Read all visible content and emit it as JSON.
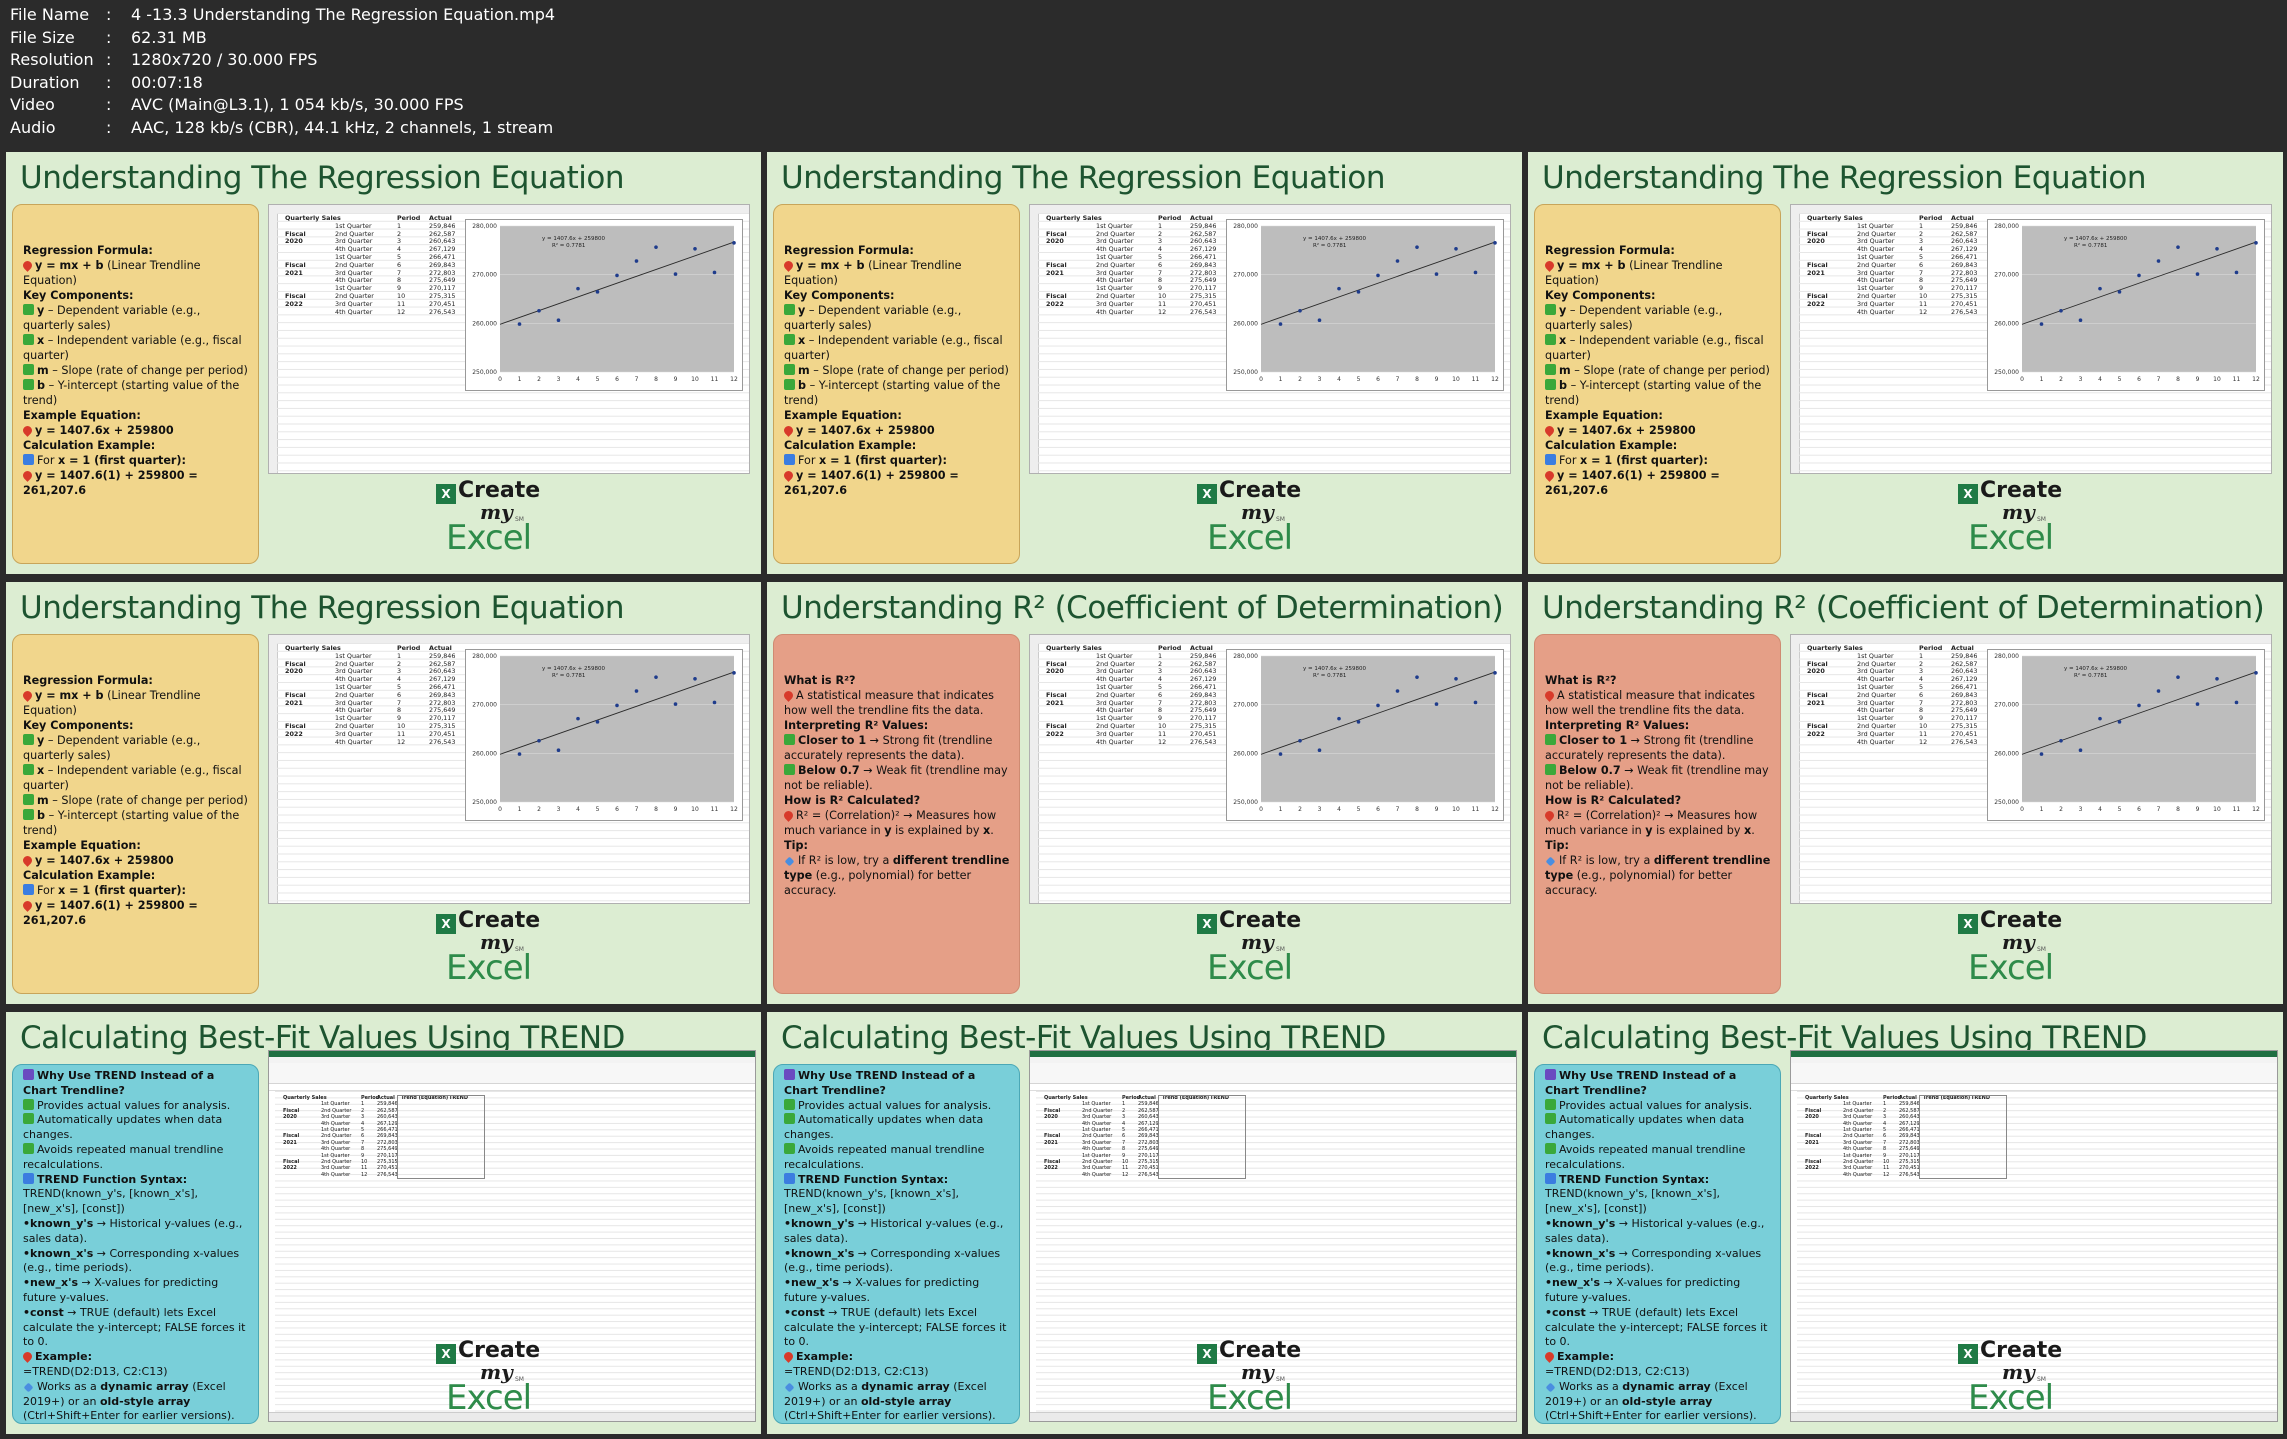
{
  "file_info": [
    {
      "key": "File Name",
      "value": "4 -13.3 Understanding The Regression Equation.mp4"
    },
    {
      "key": "File Size",
      "value": "62.31 MB"
    },
    {
      "key": "Resolution",
      "value": "1280x720 / 30.000 FPS"
    },
    {
      "key": "Duration",
      "value": "00:07:18"
    },
    {
      "key": "Video",
      "value": "AVC (Main@L3.1), 1 054 kb/s, 30.000 FPS"
    },
    {
      "key": "Audio",
      "value": "AAC, 128 kb/s (CBR), 44.1 kHz, 2 channels, 1 stream"
    }
  ],
  "slides": [
    {
      "title": "Understanding The Regression Equation",
      "panel": "regression"
    },
    {
      "title": "Understanding The Regression Equation",
      "panel": "regression"
    },
    {
      "title": "Understanding The Regression Equation",
      "panel": "regression"
    },
    {
      "title": "Understanding The Regression Equation",
      "panel": "regression"
    },
    {
      "title": "Understanding R² (Coefficient of Determination)",
      "panel": "r2"
    },
    {
      "title": "Understanding R² (Coefficient of Determination)",
      "panel": "r2"
    },
    {
      "title": "Calculating Best-Fit Values Using TREND",
      "panel": "trend"
    },
    {
      "title": "Calculating Best-Fit Values Using TREND",
      "panel": "trend"
    },
    {
      "title": "Calculating Best-Fit Values Using TREND",
      "panel": "trend"
    }
  ],
  "panels": {
    "regression": [
      [
        {
          "b": "Regression Formula:"
        }
      ],
      [
        {
          "icon": "pin"
        },
        {
          "b": "y = mx + b"
        },
        {
          "t": " (Linear Trendline Equation)"
        }
      ],
      [
        {
          "b": "Key Components:"
        }
      ],
      [
        {
          "icon": "check"
        },
        {
          "b": "y"
        },
        {
          "t": " – Dependent variable (e.g., quarterly sales)"
        }
      ],
      [
        {
          "icon": "check"
        },
        {
          "b": "x"
        },
        {
          "t": " – Independent variable (e.g., fiscal quarter)"
        }
      ],
      [
        {
          "icon": "check"
        },
        {
          "b": "m"
        },
        {
          "t": " – Slope (rate of change per period)"
        }
      ],
      [
        {
          "icon": "check"
        },
        {
          "b": "b"
        },
        {
          "t": " – Y-intercept (starting value of the trend)"
        }
      ],
      [
        {
          "b": "Example Equation:"
        }
      ],
      [
        {
          "icon": "pin"
        },
        {
          "b": "y = 1407.6x + 259800"
        }
      ],
      [
        {
          "b": "Calculation Example:"
        }
      ],
      [
        {
          "icon": "arrow"
        },
        {
          "t": "For "
        },
        {
          "b": "x = 1 (first quarter):"
        }
      ],
      [
        {
          "icon": "pin"
        },
        {
          "b": "y = 1407.6(1) + 259800 = 261,207.6"
        }
      ]
    ],
    "r2": [
      [
        {
          "b": "What is R²?"
        }
      ],
      [
        {
          "icon": "pin"
        },
        {
          "t": "A statistical measure that indicates how well the trendline fits the data."
        }
      ],
      [
        {
          "b": "Interpreting R² Values:"
        }
      ],
      [
        {
          "icon": "check"
        },
        {
          "b": "Closer to 1"
        },
        {
          "t": " → Strong fit (trendline accurately represents the data)."
        }
      ],
      [
        {
          "icon": "check"
        },
        {
          "b": "Below 0.7"
        },
        {
          "t": " → Weak fit (trendline may not be reliable)."
        }
      ],
      [
        {
          "b": "How is R² Calculated?"
        }
      ],
      [
        {
          "icon": "pin"
        },
        {
          "t": "R² = (Correlation)² → Measures how much variance in "
        },
        {
          "b": "y"
        },
        {
          "t": " is explained by "
        },
        {
          "b": "x"
        },
        {
          "t": "."
        }
      ],
      [
        {
          "b": "Tip:"
        }
      ],
      [
        {
          "icon": "diamond"
        },
        {
          "t": "If R² is low, try a "
        },
        {
          "b": "different trendline type"
        },
        {
          "t": " (e.g., polynomial) for better accuracy."
        }
      ]
    ],
    "trend": [
      [
        {
          "icon": "chart"
        },
        {
          "b": "Why Use TREND Instead of a Chart Trendline?"
        }
      ],
      [
        {
          "icon": "check"
        },
        {
          "t": "Provides actual values for analysis."
        }
      ],
      [
        {
          "icon": "check"
        },
        {
          "t": "Automatically updates when data changes."
        }
      ],
      [
        {
          "icon": "check"
        },
        {
          "t": "Avoids repeated manual trendline recalculations."
        }
      ],
      [
        {
          "icon": "arrow"
        },
        {
          "b": "TREND Function Syntax:"
        }
      ],
      [
        {
          "t": "TREND(known_y's, [known_x's], [new_x's], [const])"
        }
      ],
      [
        {
          "b": "•known_y's"
        },
        {
          "t": " → Historical y-values (e.g., sales data)."
        }
      ],
      [
        {
          "b": "•known_x's"
        },
        {
          "t": " → Corresponding x-values (e.g., time periods)."
        }
      ],
      [
        {
          "b": "•new_x's"
        },
        {
          "t": " → X-values for predicting future y-values."
        }
      ],
      [
        {
          "b": "•const"
        },
        {
          "t": " → TRUE (default) lets Excel calculate the y-intercept; FALSE forces it to 0."
        }
      ],
      [
        {
          "icon": "pin"
        },
        {
          "b": "Example:"
        }
      ],
      [
        {
          "t": "=TREND(D2:D13, C2:C13)"
        }
      ],
      [
        {
          "icon": "diamond"
        },
        {
          "t": "Works as a "
        },
        {
          "b": "dynamic array"
        },
        {
          "t": " (Excel 2019+) or an "
        },
        {
          "b": "old-style array"
        },
        {
          "t": " (Ctrl+Shift+Enter for earlier versions)."
        }
      ]
    ]
  },
  "sheet": {
    "headers": [
      "Quarterly Sales",
      "Period",
      "Actual"
    ],
    "trend_headers": [
      "Quarterly Sales",
      "Period",
      "Actual",
      "Trend (Equation)",
      "TREND"
    ],
    "rows": [
      {
        "fy": "",
        "q": "1st Quarter",
        "p": "1",
        "a": "259,846"
      },
      {
        "fy": "Fiscal",
        "q": "2nd Quarter",
        "p": "2",
        "a": "262,587"
      },
      {
        "fy": "2020",
        "q": "3rd Quarter",
        "p": "3",
        "a": "260,643"
      },
      {
        "fy": "",
        "q": "4th Quarter",
        "p": "4",
        "a": "267,129"
      },
      {
        "fy": "",
        "q": "1st Quarter",
        "p": "5",
        "a": "266,471"
      },
      {
        "fy": "Fiscal",
        "q": "2nd Quarter",
        "p": "6",
        "a": "269,843"
      },
      {
        "fy": "2021",
        "q": "3rd Quarter",
        "p": "7",
        "a": "272,803"
      },
      {
        "fy": "",
        "q": "4th Quarter",
        "p": "8",
        "a": "275,649"
      },
      {
        "fy": "",
        "q": "1st Quarter",
        "p": "9",
        "a": "270,117"
      },
      {
        "fy": "Fiscal",
        "q": "2nd Quarter",
        "p": "10",
        "a": "275,315"
      },
      {
        "fy": "2022",
        "q": "3rd Quarter",
        "p": "11",
        "a": "270,451"
      },
      {
        "fy": "",
        "q": "4th Quarter",
        "p": "12",
        "a": "276,543"
      }
    ]
  },
  "chart_data": {
    "type": "scatter",
    "x": [
      1,
      2,
      3,
      4,
      5,
      6,
      7,
      8,
      9,
      10,
      11,
      12
    ],
    "y": [
      259846,
      262587,
      260643,
      267129,
      266471,
      269843,
      272803,
      275649,
      270117,
      275315,
      270451,
      276543
    ],
    "trendline": {
      "slope": 1407.6,
      "intercept": 259800,
      "label": "y = 1407.6x + 259800",
      "r2_label": "R² = 0.7781"
    },
    "xlim": [
      0,
      12
    ],
    "ylim": [
      250000,
      280000
    ],
    "yticks": [
      "250,000",
      "260,000",
      "270,000",
      "280,000"
    ],
    "xticks": [
      "0",
      "1",
      "2",
      "3",
      "4",
      "5",
      "6",
      "7",
      "8",
      "9",
      "10",
      "11",
      "12"
    ]
  },
  "logo": {
    "create": "Create",
    "my": "my",
    "excel": "Excel",
    "sm": "SM",
    "x": "X"
  },
  "colors": {
    "yellow_panel": "#f1d68c",
    "red_panel": "#e59f87",
    "blue_panel": "#79cfd9",
    "slide_bg": "#dcedd2",
    "title": "#1d5430"
  }
}
